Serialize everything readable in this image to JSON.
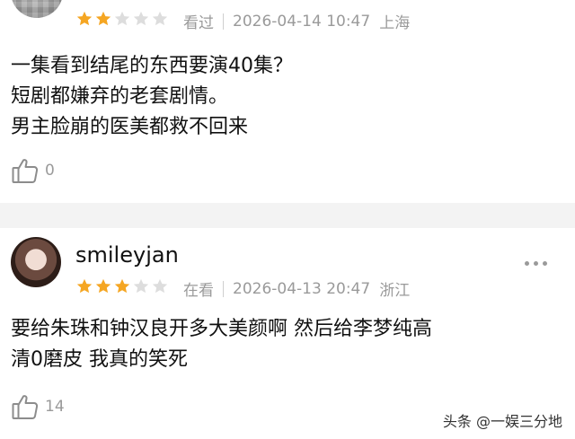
{
  "comment1": {
    "rating": 2,
    "rating_max": 5,
    "status": "看过",
    "datetime": "2026-04-14 10:47",
    "location": "上海",
    "lines": [
      "一集看到结尾的东西要演40集？",
      "短剧都嫌弃的老套剧情。",
      "男主脸崩的医美都救不回来"
    ],
    "likes": "0"
  },
  "comment2": {
    "username": "smileyjan",
    "rating": 3,
    "rating_max": 5,
    "status": "在看",
    "datetime": "2026-04-13 20:47",
    "location": "浙江",
    "lines": [
      "要给朱珠和钟汉良开多大美颜啊 然后给李梦纯高",
      "清0磨皮 我真的笑死"
    ],
    "likes": "14"
  },
  "watermark": "头条 @一娱三分地",
  "colors": {
    "star_filled": "#f5a623",
    "star_empty": "#dddddd",
    "meta_gray": "#9a9a9a"
  },
  "icons": [
    "star-icon",
    "thumbs-up-icon",
    "more-dots-icon"
  ]
}
